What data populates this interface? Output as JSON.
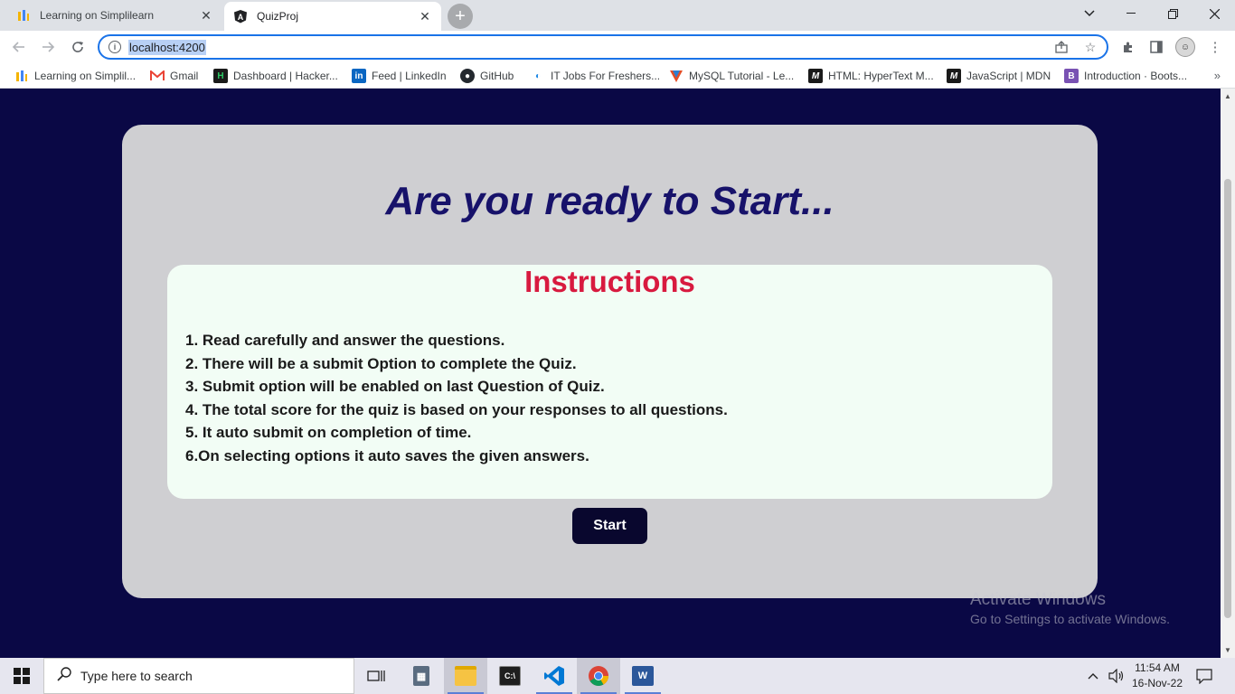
{
  "browser": {
    "tabs": [
      {
        "title": "Learning on Simplilearn",
        "favicon": "simplilearn-icon",
        "active": false
      },
      {
        "title": "QuizProj",
        "favicon": "angular-icon",
        "active": true
      }
    ],
    "address": "localhost:4200",
    "bookmarks": [
      {
        "label": "Learning on Simplil...",
        "icon": "simplilearn-icon"
      },
      {
        "label": "Gmail",
        "icon": "gmail-icon"
      },
      {
        "label": "Dashboard | Hacker...",
        "icon": "hackerrank-icon"
      },
      {
        "label": "Feed | LinkedIn",
        "icon": "linkedin-icon"
      },
      {
        "label": "GitHub",
        "icon": "github-icon"
      },
      {
        "label": "IT Jobs For Freshers...",
        "icon": "jobs-icon"
      },
      {
        "label": "MySQL Tutorial - Le...",
        "icon": "mysql-icon"
      },
      {
        "label": "HTML: HyperText M...",
        "icon": "mdn-icon"
      },
      {
        "label": "JavaScript | MDN",
        "icon": "mdn-icon"
      },
      {
        "label": "Introduction · Boots...",
        "icon": "bootstrap-icon"
      }
    ]
  },
  "page": {
    "headline": "Are you ready to Start...",
    "instructions_title": "Instructions",
    "instructions": [
      "1. Read carefully and answer the questions.",
      "2. There will be a submit Option to complete the Quiz.",
      "3. Submit option will be enabled on last Question of Quiz.",
      "4. The total score for the quiz is based on your responses to all questions.",
      "5. It auto submit on completion of time.",
      "6.On selecting options it auto saves the given answers."
    ],
    "start_label": "Start",
    "colors": {
      "background": "#0a0845",
      "card": "#cfcfd2",
      "headline": "#17126a",
      "instructions_title": "#d81a3f",
      "button": "#09072e"
    }
  },
  "watermark": {
    "line1": "Activate Windows",
    "line2": "Go to Settings to activate Windows."
  },
  "taskbar": {
    "search_placeholder": "Type here to search",
    "time": "11:54 AM",
    "date": "16-Nov-22"
  }
}
